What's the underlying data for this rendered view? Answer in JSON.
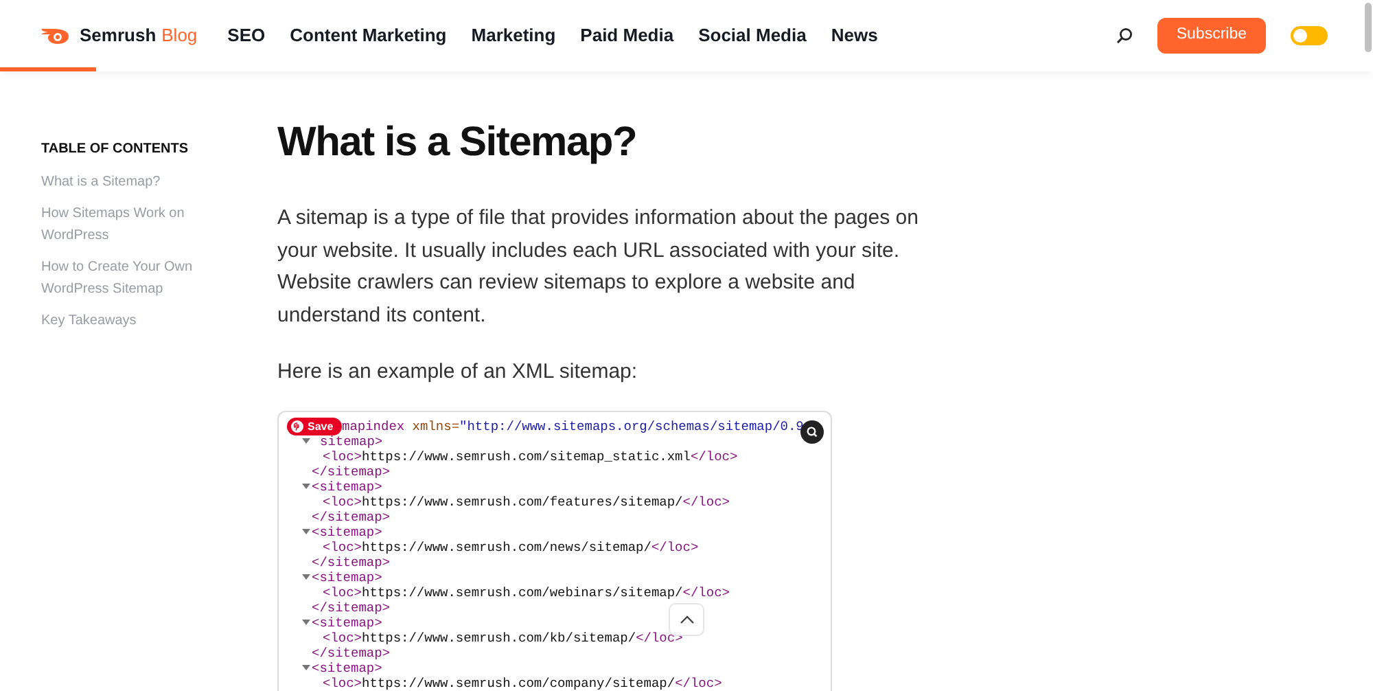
{
  "header": {
    "brand": "Semrush",
    "brand_suffix": "Blog",
    "nav": [
      {
        "label": "SEO"
      },
      {
        "label": "Content Marketing"
      },
      {
        "label": "Marketing"
      },
      {
        "label": "Paid Media"
      },
      {
        "label": "Social Media"
      },
      {
        "label": "News"
      }
    ],
    "subscribe": "Subscribe",
    "dark_mode": {
      "on": false
    }
  },
  "toc": {
    "title": "TABLE OF CONTENTS",
    "items": [
      {
        "label": "What is a Sitemap?"
      },
      {
        "label": "How Sitemaps Work on WordPress"
      },
      {
        "label": "How to Create Your Own WordPress Sitemap"
      },
      {
        "label": "Key Takeaways"
      }
    ]
  },
  "article": {
    "title": "What is a Sitemap?",
    "paragraphs": [
      "A sitemap is a type of file that provides information about the pages on your website. It usually includes each URL associated with your site. Website crawlers can review sitemaps to explore a website and understand its content.",
      "Here is an example of an XML sitemap:"
    ],
    "xml_viewer": {
      "save": "Save",
      "nodes": [
        {
          "open": [
            {
              "kind": "tag",
              "text": "mapindex"
            },
            {
              "kind": "attr",
              "text": " xmlns="
            },
            {
              "kind": "value",
              "text": "\"http://www.sitemaps.org/schemas/sitemap/0.9"
            }
          ],
          "children": [
            {
              "expanded": true,
              "open": [
                {
                  "kind": "tag",
                  "text": "sitemap>"
                }
              ],
              "children": [
                [
                  {
                    "kind": "tag",
                    "text": "<loc>"
                  },
                  {
                    "kind": "text",
                    "text": "https://www.semrush.com/sitemap_static.xml"
                  },
                  {
                    "kind": "tag",
                    "text": "</loc>"
                  }
                ]
              ],
              "close": [
                {
                  "kind": "tag",
                  "text": "</sitemap>"
                }
              ]
            },
            {
              "expanded": true,
              "open": [
                {
                  "kind": "tag",
                  "text": "<sitemap>"
                }
              ],
              "children": [
                [
                  {
                    "kind": "tag",
                    "text": "<loc>"
                  },
                  {
                    "kind": "text",
                    "text": "https://www.semrush.com/features/sitemap/"
                  },
                  {
                    "kind": "tag",
                    "text": "</loc>"
                  }
                ]
              ],
              "close": [
                {
                  "kind": "tag",
                  "text": "</sitemap>"
                }
              ]
            },
            {
              "expanded": true,
              "open": [
                {
                  "kind": "tag",
                  "text": "<sitemap>"
                }
              ],
              "children": [
                [
                  {
                    "kind": "tag",
                    "text": "<loc>"
                  },
                  {
                    "kind": "text",
                    "text": "https://www.semrush.com/news/sitemap/"
                  },
                  {
                    "kind": "tag",
                    "text": "</loc>"
                  }
                ]
              ],
              "close": [
                {
                  "kind": "tag",
                  "text": "</sitemap>"
                }
              ]
            },
            {
              "expanded": true,
              "open": [
                {
                  "kind": "tag",
                  "text": "<sitemap>"
                }
              ],
              "children": [
                [
                  {
                    "kind": "tag",
                    "text": "<loc>"
                  },
                  {
                    "kind": "text",
                    "text": "https://www.semrush.com/webinars/sitemap/"
                  },
                  {
                    "kind": "tag",
                    "text": "</loc>"
                  }
                ]
              ],
              "close": [
                {
                  "kind": "tag",
                  "text": "</sitemap>"
                }
              ]
            },
            {
              "expanded": true,
              "open": [
                {
                  "kind": "tag",
                  "text": "<sitemap>"
                }
              ],
              "children": [
                [
                  {
                    "kind": "tag",
                    "text": "<loc>"
                  },
                  {
                    "kind": "text",
                    "text": "https://www.semrush.com/kb/sitemap/"
                  },
                  {
                    "kind": "tag",
                    "text": "</loc>"
                  }
                ]
              ],
              "close": [
                {
                  "kind": "tag",
                  "text": "</sitemap>"
                }
              ]
            },
            {
              "expanded": true,
              "open": [
                {
                  "kind": "tag",
                  "text": "<sitemap>"
                }
              ],
              "children": [
                [
                  {
                    "kind": "tag",
                    "text": "<loc>"
                  },
                  {
                    "kind": "text",
                    "text": "https://www.semrush.com/company/sitemap/"
                  },
                  {
                    "kind": "tag",
                    "text": "</loc>"
                  }
                ]
              ]
            }
          ]
        }
      ]
    }
  }
}
